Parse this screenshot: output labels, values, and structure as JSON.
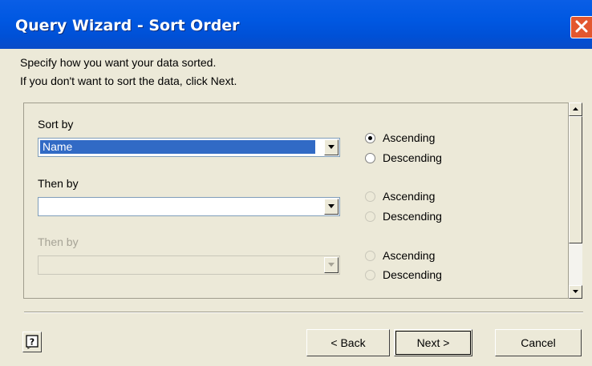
{
  "window": {
    "title": "Query Wizard - Sort Order"
  },
  "instructions": {
    "line1": "Specify how you want your data sorted.",
    "line2": "If you don't want to sort the data, click Next."
  },
  "sort_levels": [
    {
      "label": "Sort by",
      "value": "Name",
      "ascending_label": "Ascending",
      "descending_label": "Descending",
      "selected": "ascending",
      "enabled": true
    },
    {
      "label": "Then by",
      "value": "",
      "ascending_label": "Ascending",
      "descending_label": "Descending",
      "selected": "none",
      "enabled": true,
      "options_enabled": false
    },
    {
      "label": "Then by",
      "value": "",
      "ascending_label": "Ascending",
      "descending_label": "Descending",
      "selected": "none",
      "enabled": false
    }
  ],
  "buttons": {
    "back": "< Back",
    "next": "Next >",
    "cancel": "Cancel"
  },
  "icons": {
    "close": "close-icon",
    "help": "help-icon",
    "dropdown": "chevron-down-icon"
  },
  "colors": {
    "title_bar": "#0058e2",
    "selection": "#316ac5",
    "close": "#e3572f",
    "dialog_bg": "#ece9d8"
  }
}
